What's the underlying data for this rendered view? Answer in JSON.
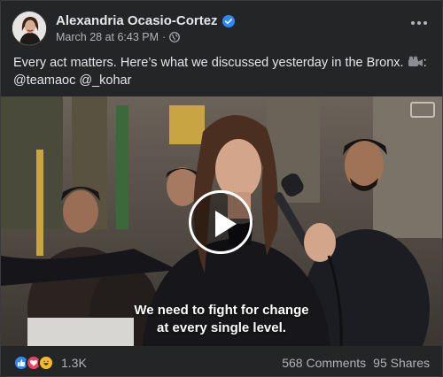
{
  "post": {
    "author_name": "Alexandria Ocasio-Cortez",
    "timestamp": "March 28 at 6:43 PM",
    "separator": "·",
    "text_line1": "Every act matters. Here’s what we discussed yesterday in the Bronx.",
    "text_line1_suffix": ":",
    "text_line2": "@teamaoc @_kohar"
  },
  "video": {
    "caption_line1": "We need to fight for change",
    "caption_line2": "at every single level."
  },
  "footer": {
    "reactions": [
      "like-icon",
      "love-icon",
      "haha-icon"
    ],
    "reaction_count": "1.3K",
    "comments": "568 Comments",
    "shares": "95 Shares"
  },
  "colors": {
    "background": "#242526",
    "text_primary": "#e4e6eb",
    "text_secondary": "#b0b3b8",
    "verified_blue": "#2e89ff",
    "like_blue": "#2e89ff",
    "love_red": "#f33e58",
    "haha_yellow": "#f7b928"
  }
}
